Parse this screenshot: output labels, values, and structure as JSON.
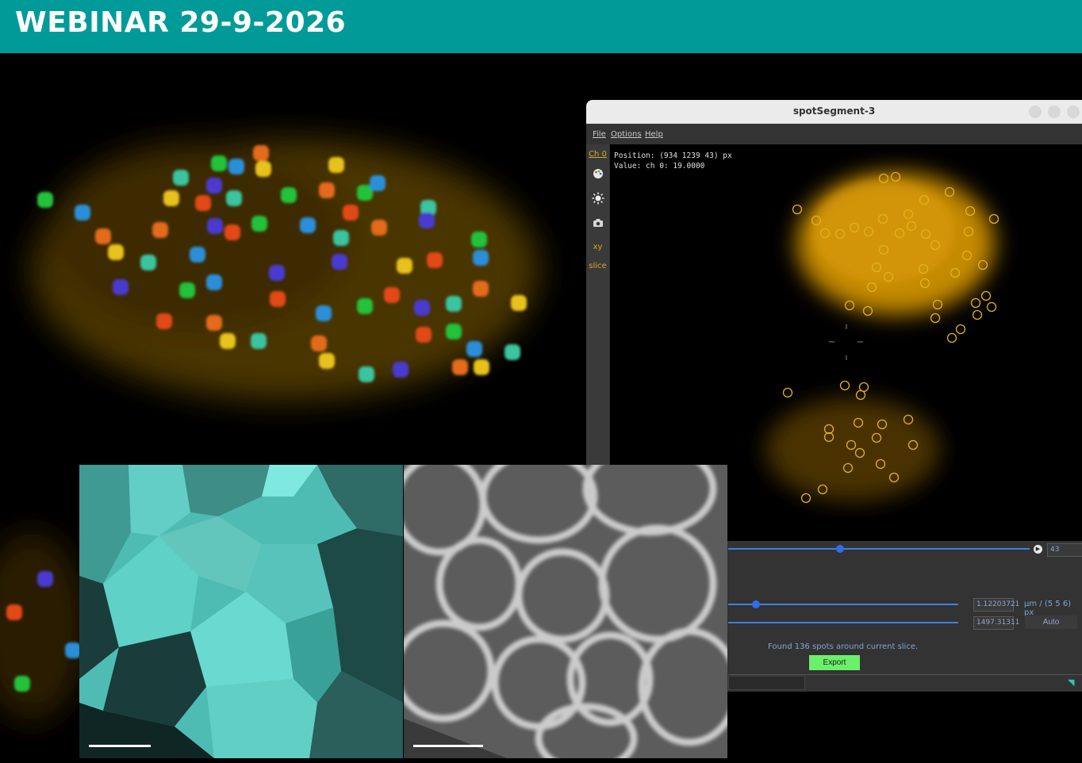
{
  "banner": {
    "title": "WEBINAR 29-9-2026",
    "color": "#009b98"
  },
  "window": {
    "title": "spotSegment-3",
    "controls": {
      "slice_value": "43",
      "slice_level": 0.37,
      "spot_size_value": "1.12203721",
      "spot_size_level": 0.12,
      "threshold_value": "1497.31311",
      "threshold_level": 1.0,
      "unit_label": "µm / (5 5 6) px",
      "auto_label": "Auto",
      "status_text": "Found 136 spots around current slice.",
      "export_label": "Export"
    },
    "menu": [
      "File",
      "Options",
      "Help"
    ],
    "toolbar": {
      "channel": "Ch 0",
      "xy": "xy",
      "slice": "slice",
      "icons": [
        "palette-icon",
        "brightness-icon",
        "camera-icon"
      ]
    },
    "viewer": {
      "position_text": "Position: (934 1239 43) px",
      "value_text": "Value: ch 0: 19.0000"
    }
  },
  "colors": {
    "accent_blue": "#3d7fe3",
    "export_green": "#6bf06b",
    "spot_ring": "#e0b21a",
    "segmentation_cyan": "#4bb9b1"
  },
  "images": {
    "background": "fluorescence-cluster-image",
    "segmentation": "segmentation-label-image",
    "grayscale": "membrane-grayscale-image"
  }
}
